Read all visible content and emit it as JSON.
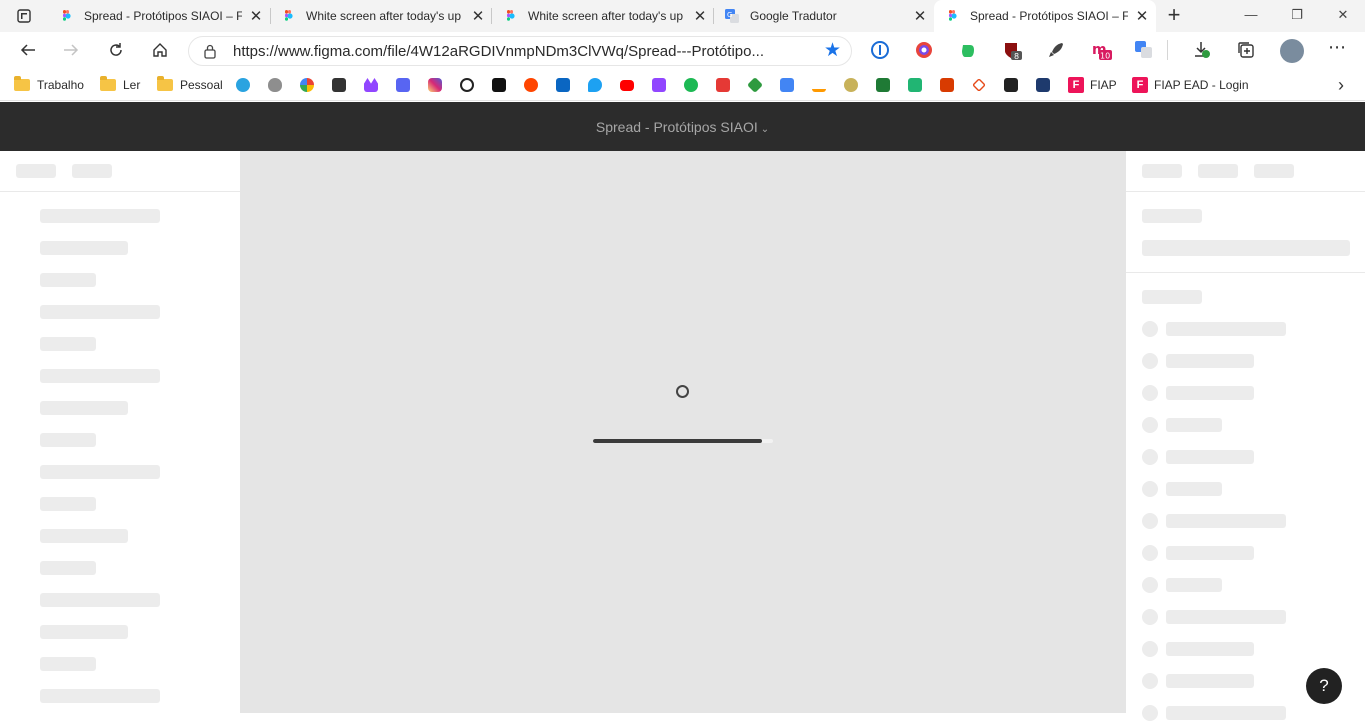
{
  "tabs": [
    {
      "title": "Spread - Protótipos SIAOI – F",
      "favicon": "figma-icon",
      "active": false
    },
    {
      "title": "White screen after today's up",
      "favicon": "figma-icon",
      "active": false
    },
    {
      "title": "White screen after today's up",
      "favicon": "figma-icon",
      "active": false
    },
    {
      "title": "Google Tradutor",
      "favicon": "google-translate-icon",
      "active": false
    },
    {
      "title": "Spread - Protótipos SIAOI – F",
      "favicon": "figma-icon",
      "active": true
    }
  ],
  "window_controls": {
    "minimize": "—",
    "restore": "❐",
    "close": "✕"
  },
  "address_bar": {
    "url": "https://www.figma.com/file/4W12aRGDIVnmpNDm3ClVWq/Spread---Protótipo..."
  },
  "bookmarks": {
    "folders": [
      "Trabalho",
      "Ler",
      "Pessoal"
    ],
    "fiap": "FIAP",
    "fiap_ead": "FIAP EAD - Login"
  },
  "badges": {
    "ublock": "8",
    "extension_counter": "10"
  },
  "figma": {
    "file_title": "Spread - Protótipos SIAOI",
    "loading_progress": 0.94,
    "help_label": "?"
  },
  "colors": {
    "figma_header": "#2c2c2c",
    "canvas": "#e5e5e5",
    "skeleton": "#ececec",
    "accent_blue": "#1a73e8"
  }
}
